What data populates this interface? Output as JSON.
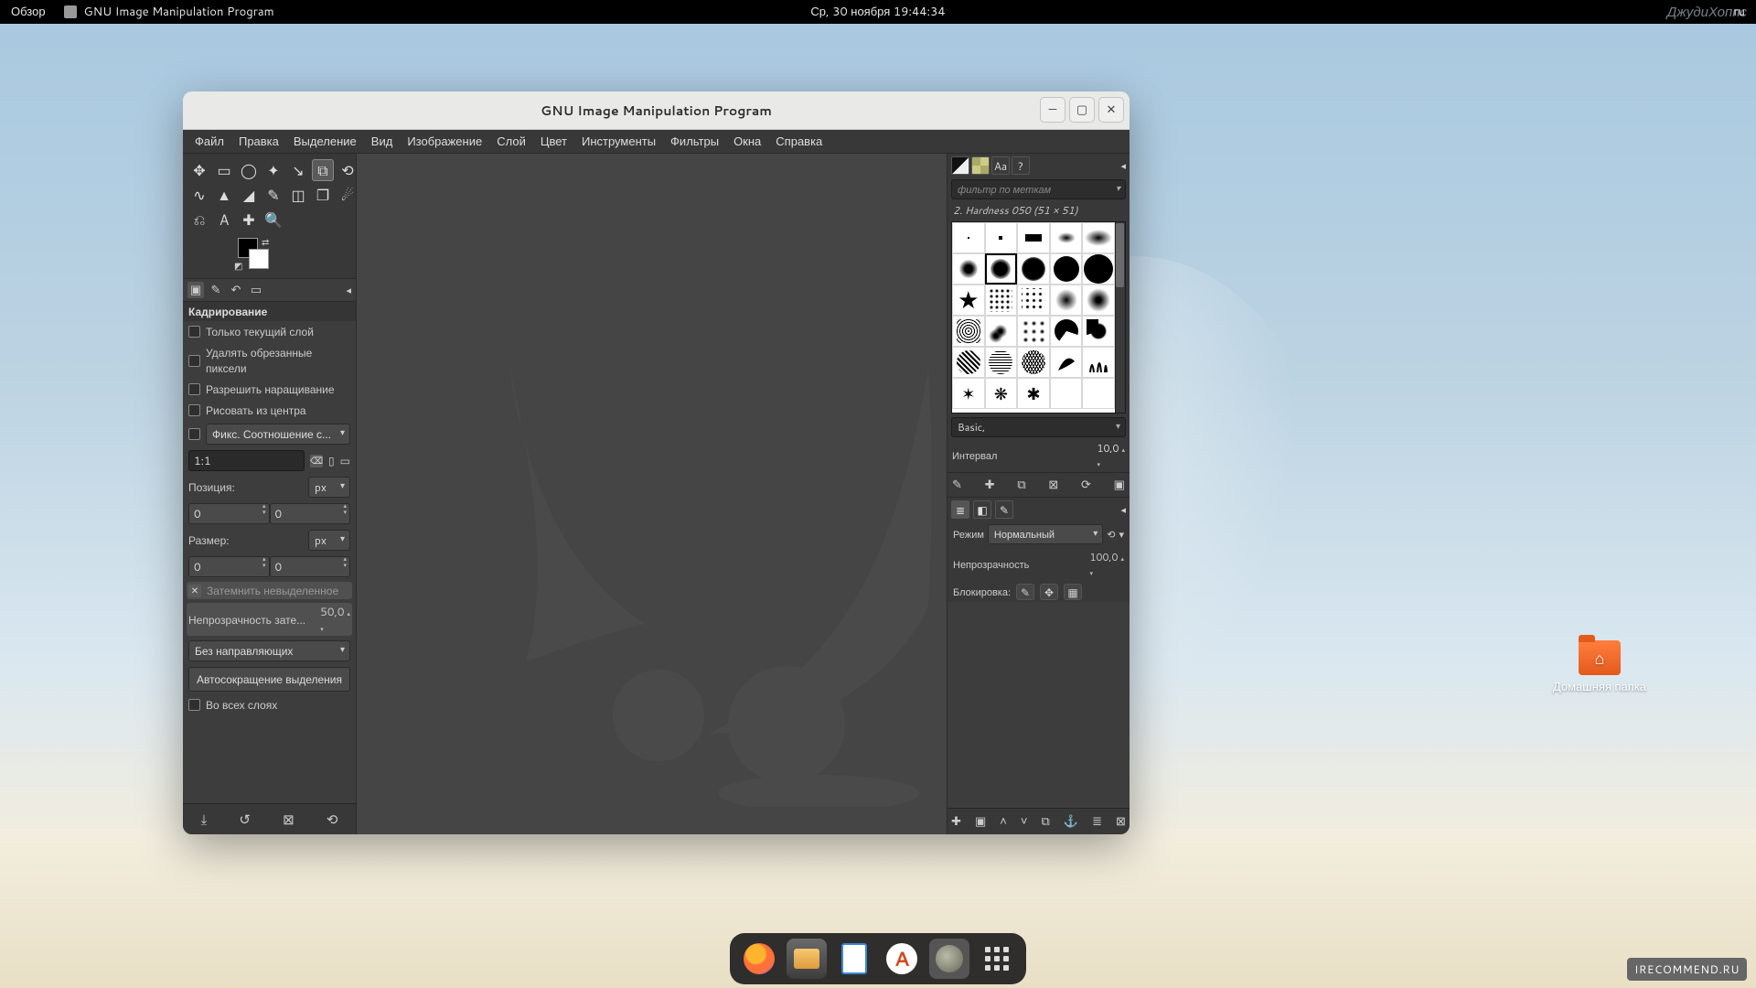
{
  "top_bar": {
    "activities": "Обзор",
    "app_name": "GNU Image Manipulation Program",
    "datetime": "Ср, 30 ноября  19:44:34",
    "lang": "ru"
  },
  "watermark_user": "ДжудиХоппс",
  "watermark": "IRECOMMEND.RU",
  "desktop": {
    "home_folder": "Домашняя папка"
  },
  "dock_items": [
    "firefox",
    "files",
    "document",
    "software",
    "gimp",
    "apps"
  ],
  "window": {
    "title": "GNU Image Manipulation Program",
    "menus": [
      "Файл",
      "Правка",
      "Выделение",
      "Вид",
      "Изображение",
      "Слой",
      "Цвет",
      "Инструменты",
      "Фильтры",
      "Окна",
      "Справка"
    ]
  },
  "toolbox": {
    "tools": [
      "move",
      "align",
      "lasso",
      "fuzzy",
      "crop",
      "flip",
      "warp",
      "bucket",
      "gradient",
      "pencil",
      "eraser",
      "clone",
      "smudge",
      "dodge",
      "measure",
      "text",
      "path",
      "zoom"
    ],
    "selected": "crop"
  },
  "tool_options": {
    "title": "Кадрирование",
    "checks": {
      "current_layer": "Только текущий слой",
      "delete_cropped": "Удалять обрезанные пиксели",
      "allow_growing": "Разрешить наращивание",
      "from_center": "Рисовать из центра",
      "highlight": "Затемнить невыделенное",
      "all_layers": "Во всех слоях"
    },
    "fixed_label": "Фикс.",
    "fixed_option": "Соотношение с…",
    "ratio_value": "1:1",
    "position_label": "Позиция:",
    "position_unit": "px",
    "pos_x": "0",
    "pos_y": "0",
    "size_label": "Размер:",
    "size_unit": "px",
    "size_w": "0",
    "size_h": "0",
    "highlight_opacity_label": "Непрозрачность зате…",
    "highlight_opacity_value": "50,0",
    "guides_option": "Без направляющих",
    "autoshrink": "Автосокращение выделения"
  },
  "brushes": {
    "tabs": [
      "brush",
      "pattern",
      "font",
      "help"
    ],
    "filter_placeholder": "фильтр по меткам",
    "selected_name": "2. Hardness 050 (51 × 51)",
    "preset_set": "Basic,",
    "spacing_label": "Интервал",
    "spacing_value": "10,0"
  },
  "layers": {
    "tabs": [
      "layers",
      "channels",
      "paths"
    ],
    "mode_label": "Режим",
    "mode_value": "Нормальный",
    "opacity_label": "Непрозрачность",
    "opacity_value": "100,0",
    "lock_label": "Блокировка:"
  }
}
